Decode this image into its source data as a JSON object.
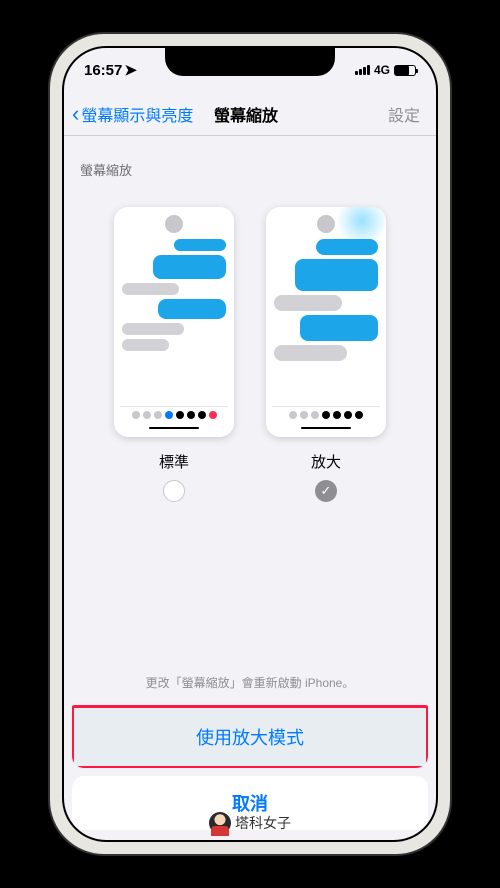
{
  "status": {
    "time": "16:57",
    "network": "4G"
  },
  "nav": {
    "back_label": "螢幕顯示與亮度",
    "title": "螢幕縮放",
    "right_label": "設定"
  },
  "section": {
    "header": "螢幕縮放"
  },
  "options": {
    "standard": {
      "label": "標準",
      "selected": false
    },
    "zoomed": {
      "label": "放大",
      "selected": true
    }
  },
  "sheet": {
    "message": "更改「螢幕縮放」會重新啟動 iPhone。",
    "confirm_label": "使用放大模式",
    "cancel_label": "取消"
  },
  "watermark": {
    "text": "塔科女子"
  }
}
